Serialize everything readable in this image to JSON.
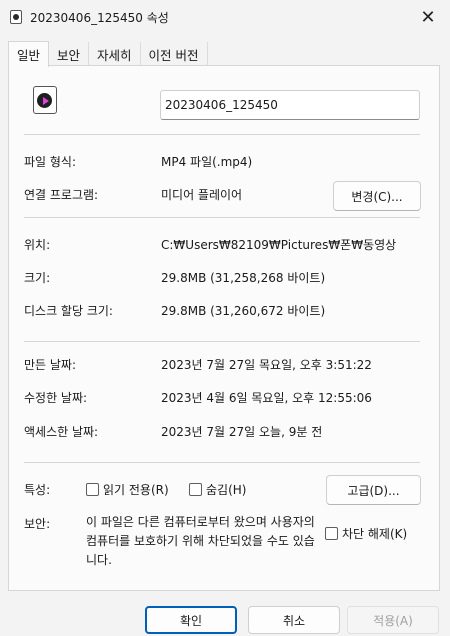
{
  "window": {
    "title": "20230406_125450 속성",
    "close_glyph": "✕"
  },
  "tabs": [
    {
      "label": "일반",
      "active": true
    },
    {
      "label": "보안",
      "active": false
    },
    {
      "label": "자세히",
      "active": false
    },
    {
      "label": "이전 버전",
      "active": false
    }
  ],
  "file": {
    "name": "20230406_125450",
    "icon": "video-file-icon"
  },
  "info": {
    "type_label": "파일 형식:",
    "type_value": "MP4 파일(.mp4)",
    "program_label": "연결 프로그램:",
    "program_value": "미디어 플레이어",
    "change_button": "변경(C)...",
    "location_label": "위치:",
    "location_value": "C:₩Users₩82109₩Pictures₩폰₩동영상",
    "size_label": "크기:",
    "size_value": "29.8MB (31,258,268 바이트)",
    "disk_size_label": "디스크 할당 크기:",
    "disk_size_value": "29.8MB (31,260,672 바이트)",
    "created_label": "만든 날짜:",
    "created_value": "2023년 7월 27일 목요일, 오후 3:51:22",
    "modified_label": "수정한 날짜:",
    "modified_value": "2023년 4월 6일 목요일, 오후 12:55:06",
    "accessed_label": "액세스한 날짜:",
    "accessed_value": "2023년 7월 27일 오늘, 9분 전"
  },
  "attributes": {
    "label": "특성:",
    "readonly": "읽기 전용(R)",
    "hidden": "숨김(H)",
    "advanced_button": "고급(D)..."
  },
  "security": {
    "label": "보안:",
    "message": "이 파일은 다른 컴퓨터로부터 왔으며 사용자의 컴퓨터를 보호하기 위해 차단되었을 수도 있습니다.",
    "unblock": "차단 해제(K)"
  },
  "footer": {
    "ok": "확인",
    "cancel": "취소",
    "apply": "적용(A)"
  }
}
